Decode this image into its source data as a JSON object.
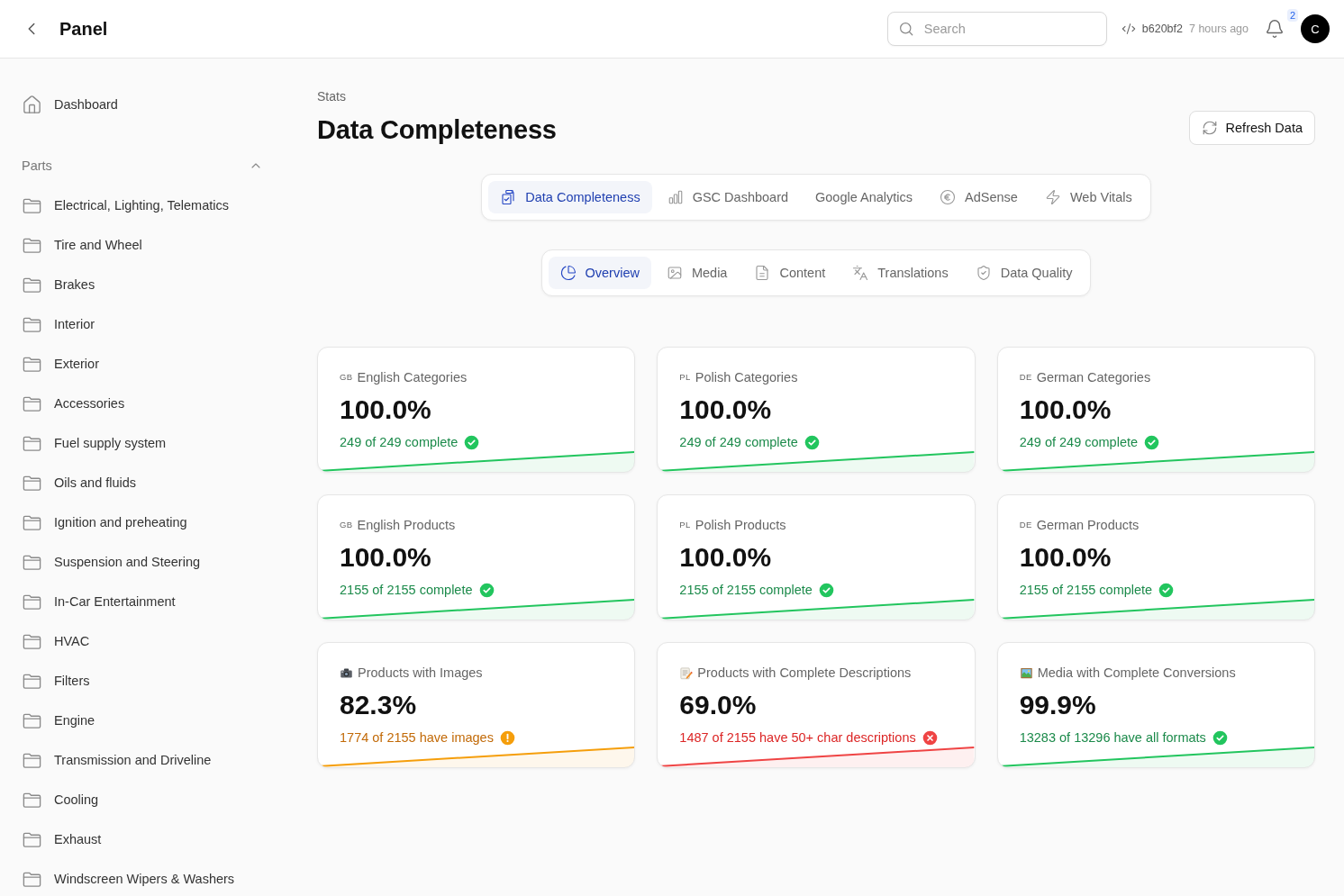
{
  "header": {
    "title": "Panel",
    "search": {
      "placeholder": "Search"
    },
    "commit": {
      "hash": "b620bf2",
      "time": "7 hours ago"
    },
    "notifications": {
      "count": "2"
    },
    "avatar": {
      "initial": "C"
    }
  },
  "sidebar": {
    "items": [
      {
        "label": "Dashboard"
      }
    ],
    "sections": [
      {
        "title": "Parts",
        "expanded": true,
        "items": [
          {
            "label": "Electrical, Lighting, Telematics"
          },
          {
            "label": "Tire and Wheel"
          },
          {
            "label": "Brakes"
          },
          {
            "label": "Interior"
          },
          {
            "label": "Exterior"
          },
          {
            "label": "Accessories"
          },
          {
            "label": "Fuel supply system"
          },
          {
            "label": "Oils and fluids"
          },
          {
            "label": "Ignition and preheating"
          },
          {
            "label": "Suspension and Steering"
          },
          {
            "label": "In-Car Entertainment"
          },
          {
            "label": "HVAC"
          },
          {
            "label": "Filters"
          },
          {
            "label": "Engine"
          },
          {
            "label": "Transmission and Driveline"
          },
          {
            "label": "Cooling"
          },
          {
            "label": "Exhaust"
          },
          {
            "label": "Windscreen Wipers & Washers"
          }
        ]
      }
    ]
  },
  "page": {
    "breadcrumb": "Stats",
    "title": "Data Completeness",
    "refresh_button": "Refresh Data"
  },
  "main_tabs": [
    {
      "label": "Data Completeness",
      "selected": true
    },
    {
      "label": "GSC Dashboard",
      "selected": false
    },
    {
      "label": "Google Analytics",
      "selected": false
    },
    {
      "label": "AdSense",
      "selected": false
    },
    {
      "label": "Web Vitals",
      "selected": false
    }
  ],
  "sub_tabs": [
    {
      "label": "Overview",
      "selected": true
    },
    {
      "label": "Media",
      "selected": false
    },
    {
      "label": "Content",
      "selected": false
    },
    {
      "label": "Translations",
      "selected": false
    },
    {
      "label": "Data Quality",
      "selected": false
    }
  ],
  "cards": [
    {
      "flag": "GB",
      "label": "English Categories",
      "value": "100.0%",
      "detail": "249 of 249 complete",
      "kind": "complete"
    },
    {
      "flag": "PL",
      "label": "Polish Categories",
      "value": "100.0%",
      "detail": "249 of 249 complete",
      "kind": "complete"
    },
    {
      "flag": "DE",
      "label": "German Categories",
      "value": "100.0%",
      "detail": "249 of 249 complete",
      "kind": "complete"
    },
    {
      "flag": "GB",
      "label": "English Products",
      "value": "100.0%",
      "detail": "2155 of 2155 complete",
      "kind": "complete"
    },
    {
      "flag": "PL",
      "label": "Polish Products",
      "value": "100.0%",
      "detail": "2155 of 2155 complete",
      "kind": "complete"
    },
    {
      "flag": "DE",
      "label": "German Products",
      "value": "100.0%",
      "detail": "2155 of 2155 complete",
      "kind": "complete"
    },
    {
      "label": "Products with Images",
      "value": "82.3%",
      "detail": "1774 of 2155 have images",
      "kind": "warning"
    },
    {
      "label": "Products with Complete Descriptions",
      "value": "69.0%",
      "detail": "1487 of 2155 have 50+ char descriptions",
      "kind": "error"
    },
    {
      "label": "Media with Complete Conversions",
      "value": "99.9%",
      "detail": "13283 of 13296 have all formats",
      "kind": "complete"
    }
  ]
}
